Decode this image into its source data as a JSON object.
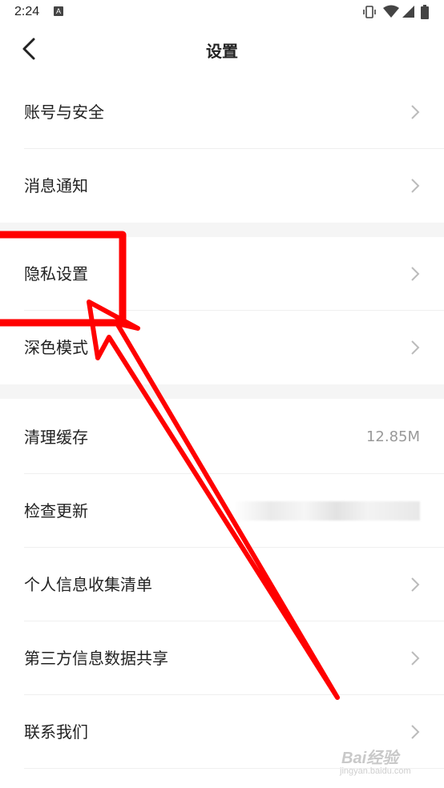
{
  "status_bar": {
    "time": "2:24",
    "notification_glyph": "A",
    "icons": [
      "vibrate-icon",
      "wifi-icon",
      "signal-icon",
      "battery-icon"
    ]
  },
  "header": {
    "title": "设置",
    "back_icon": "chevron-left-icon"
  },
  "sections": [
    {
      "items": [
        {
          "label": "账号与安全",
          "icon": "chevron-right-icon"
        },
        {
          "label": "消息通知",
          "icon": "chevron-right-icon"
        }
      ]
    },
    {
      "items": [
        {
          "label": "隐私设置",
          "icon": "chevron-right-icon"
        },
        {
          "label": "深色模式",
          "icon": "chevron-right-icon"
        }
      ]
    },
    {
      "items": [
        {
          "label": "清理缓存",
          "value": "12.85M"
        },
        {
          "label": "检查更新",
          "value_blurred": true
        },
        {
          "label": "个人信息收集清单",
          "icon": "chevron-right-icon"
        },
        {
          "label": "第三方信息数据共享",
          "icon": "chevron-right-icon"
        },
        {
          "label": "联系我们",
          "icon": "chevron-right-icon"
        }
      ]
    }
  ],
  "annotation": {
    "color": "#ff0000"
  },
  "watermark": {
    "text": "Bai经验",
    "sub": "jingyan.baidu.com"
  },
  "colors": {
    "background": "#ffffff",
    "section_gap": "#f5f5f5",
    "value_text": "#999999",
    "chevron": "#bbbbbb"
  }
}
